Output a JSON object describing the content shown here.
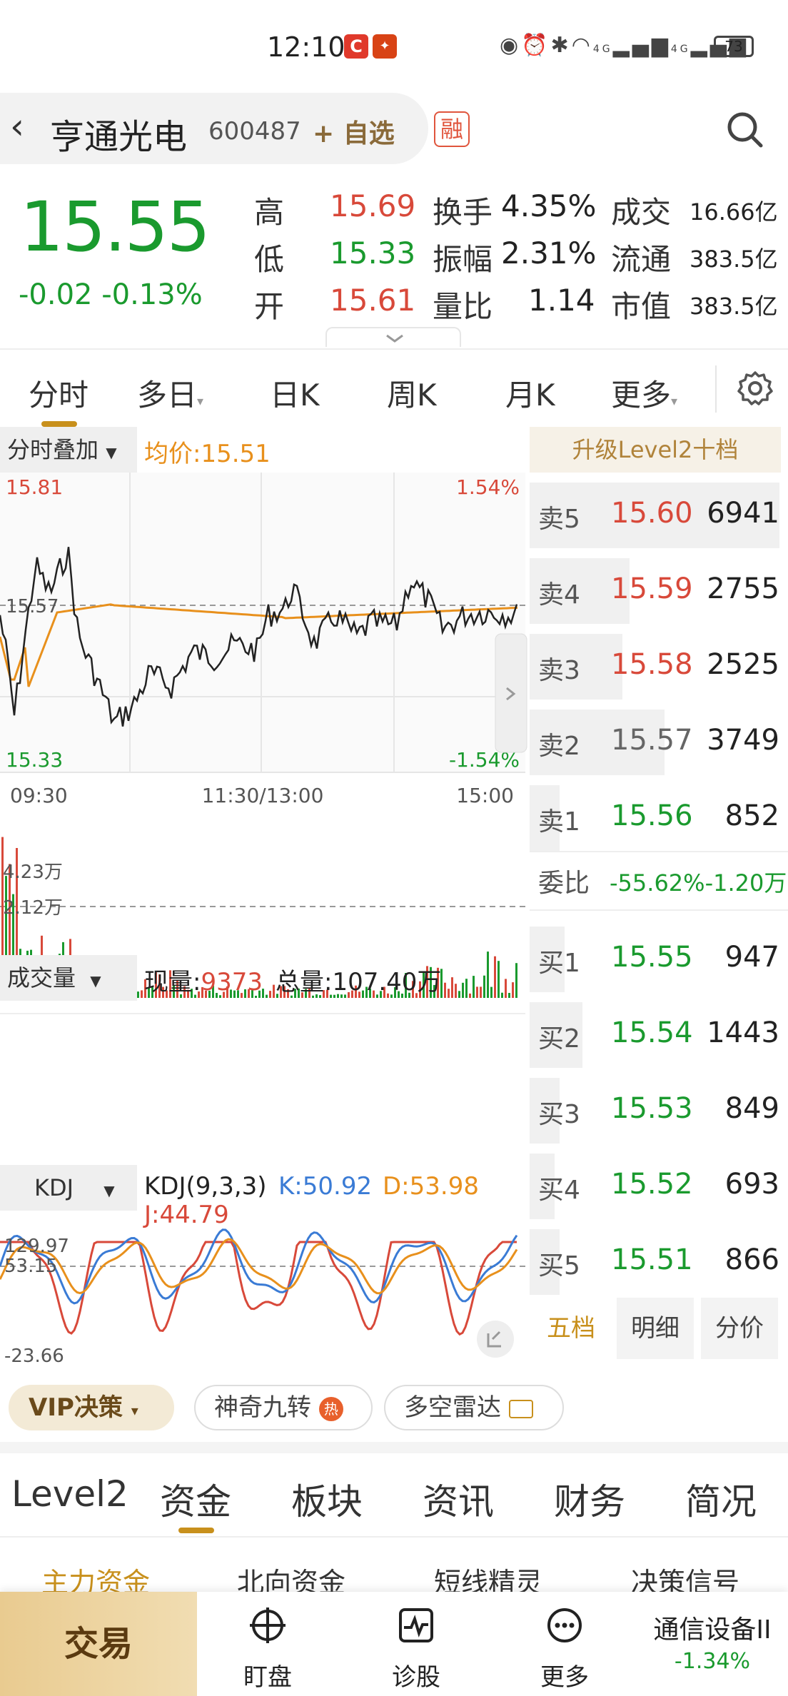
{
  "status_bar": {
    "time": "12:10",
    "battery": "73",
    "signal_labels": [
      "4G",
      "4G"
    ],
    "icons": [
      "eye-icon",
      "alarm-icon",
      "bluetooth-icon",
      "wifi-icon",
      "signal-icon",
      "signal-icon"
    ]
  },
  "header": {
    "back_icon": "chevron-left-icon",
    "stock_name": "亨通光电",
    "stock_code": "600487",
    "add_watch": "+ 自选",
    "margin_badge": "融",
    "search_icon": "search-icon"
  },
  "quote": {
    "price": "15.55",
    "change": "-0.02 -0.13%",
    "rows": [
      {
        "label": "高",
        "value": "15.69",
        "label2": "换手",
        "value2": "4.35%",
        "label3": "成交",
        "value3": "16.66亿"
      },
      {
        "label": "低",
        "value": "15.33",
        "label2": "振幅",
        "value2": "2.31%",
        "label3": "流通",
        "value3": "383.5亿"
      },
      {
        "label": "开",
        "value": "15.61",
        "label2": "量比",
        "value2": "1.14",
        "label3": "市值",
        "value3": "383.5亿"
      }
    ]
  },
  "chart_tabs": {
    "items": [
      "分时",
      "多日",
      "日K",
      "周K",
      "月K",
      "更多"
    ],
    "active": "分时"
  },
  "timeshare": {
    "overlay_btn": "分时叠加",
    "avg_label": "均价:15.51",
    "y_top": "15.81",
    "y_mid": "15.57",
    "y_bot": "15.33",
    "pct_top": "1.54%",
    "pct_bot": "-1.54%",
    "x_labels": [
      "09:30",
      "11:30/13:00",
      "15:00"
    ]
  },
  "volume": {
    "btn": "成交量",
    "now_label": "现量:",
    "now_value": "9373",
    "total": "总量:107.40万",
    "y_top": "4.23万",
    "y_mid": "2.12万"
  },
  "kdj": {
    "btn": "KDJ",
    "params": "KDJ(9,3,3)",
    "k": "K:50.92",
    "d": "D:53.98",
    "j": "J:44.79",
    "y_top": "129.97",
    "y_mid": "53.15",
    "y_bot": "-23.66"
  },
  "orderbook": {
    "title": "升级Level2十档",
    "asks": [
      {
        "label": "卖5",
        "price": "15.60",
        "vol": "6941",
        "bar": 1.0,
        "color": "red"
      },
      {
        "label": "卖4",
        "price": "15.59",
        "vol": "2755",
        "bar": 0.4,
        "color": "red"
      },
      {
        "label": "卖3",
        "price": "15.58",
        "vol": "2525",
        "bar": 0.37,
        "color": "red"
      },
      {
        "label": "卖2",
        "price": "15.57",
        "vol": "3749",
        "bar": 0.54,
        "color": "gray"
      },
      {
        "label": "卖1",
        "price": "15.56",
        "vol": "852",
        "bar": 0.12,
        "color": "green"
      }
    ],
    "ratio_label": "委比",
    "ratio_value": "-55.62%-1.20万",
    "bids": [
      {
        "label": "买1",
        "price": "15.55",
        "vol": "947",
        "bar": 0.14,
        "color": "green"
      },
      {
        "label": "买2",
        "price": "15.54",
        "vol": "1443",
        "bar": 0.21,
        "color": "green"
      },
      {
        "label": "买3",
        "price": "15.53",
        "vol": "849",
        "bar": 0.12,
        "color": "green"
      },
      {
        "label": "买4",
        "price": "15.52",
        "vol": "693",
        "bar": 0.1,
        "color": "green"
      },
      {
        "label": "买5",
        "price": "15.51",
        "vol": "866",
        "bar": 0.12,
        "color": "green"
      }
    ],
    "tabs": [
      "五档",
      "明细",
      "分价"
    ]
  },
  "chips": {
    "vip": "VIP决策",
    "nine": "神奇九转",
    "hot_badge": "热",
    "radar": "多空雷达"
  },
  "section_tabs": {
    "items": [
      "Level2",
      "资金",
      "板块",
      "资讯",
      "财务",
      "简况"
    ],
    "active": "资金"
  },
  "sub_tabs": [
    "主力资金",
    "北向资金",
    "短线精灵",
    "决策信号"
  ],
  "bottom_nav": {
    "trade": "交易",
    "items": [
      {
        "label": "盯盘",
        "icon": "target-icon"
      },
      {
        "label": "诊股",
        "icon": "pulse-chart-icon"
      },
      {
        "label": "更多",
        "icon": "more-dots-icon"
      }
    ],
    "sector_name": "通信设备II",
    "sector_change": "-1.34%"
  },
  "colors": {
    "up": "#d8493a",
    "down": "#1a9a2e",
    "accent": "#c8901c",
    "price_line": "#222222",
    "avg_line": "#e8901c",
    "k_line": "#3a7bd5",
    "d_line": "#e8901c",
    "j_line": "#d8493a"
  }
}
